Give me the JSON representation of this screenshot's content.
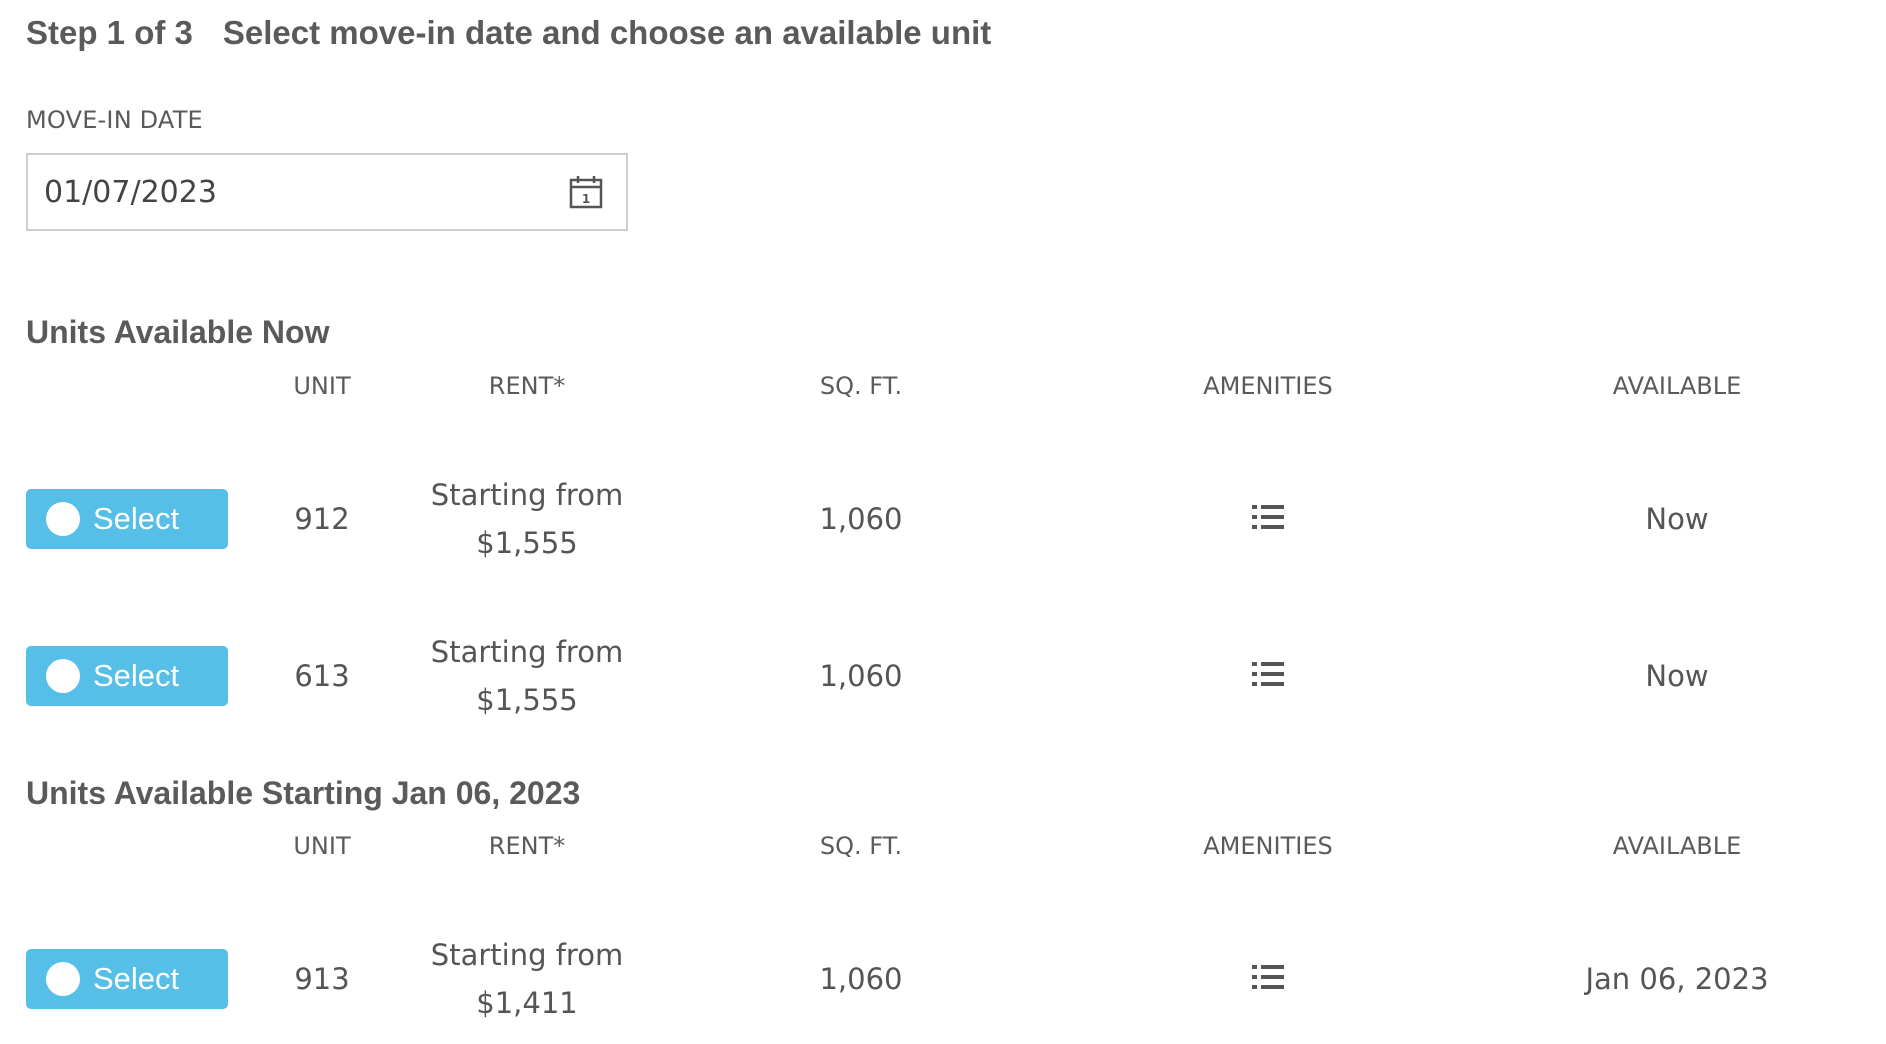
{
  "header": {
    "step": "Step 1 of 3",
    "title": "Select move-in date and choose an available unit"
  },
  "move_in": {
    "label": "MOVE-IN DATE",
    "value": "01/07/2023",
    "icon": "calendar-icon"
  },
  "columns": {
    "unit": "UNIT",
    "rent": "RENT*",
    "sqft": "SQ. FT.",
    "amenities": "AMENITIES",
    "available": "AVAILABLE"
  },
  "sections": [
    {
      "title": "Units Available Now",
      "units": [
        {
          "select_label": "Select",
          "unit": "912",
          "rent_prefix": "Starting from",
          "rent": "$1,555",
          "sqft": "1,060",
          "amenities_icon": "list-icon",
          "available": "Now"
        },
        {
          "select_label": "Select",
          "unit": "613",
          "rent_prefix": "Starting from",
          "rent": "$1,555",
          "sqft": "1,060",
          "amenities_icon": "list-icon",
          "available": "Now"
        }
      ]
    },
    {
      "title": "Units Available Starting Jan 06, 2023",
      "units": [
        {
          "select_label": "Select",
          "unit": "913",
          "rent_prefix": "Starting from",
          "rent": "$1,411",
          "sqft": "1,060",
          "amenities_icon": "list-icon",
          "available": "Jan 06, 2023"
        }
      ]
    }
  ],
  "colors": {
    "select_button": "#56bfe8",
    "text": "#5a5a5a",
    "border": "#cfcfcf"
  }
}
